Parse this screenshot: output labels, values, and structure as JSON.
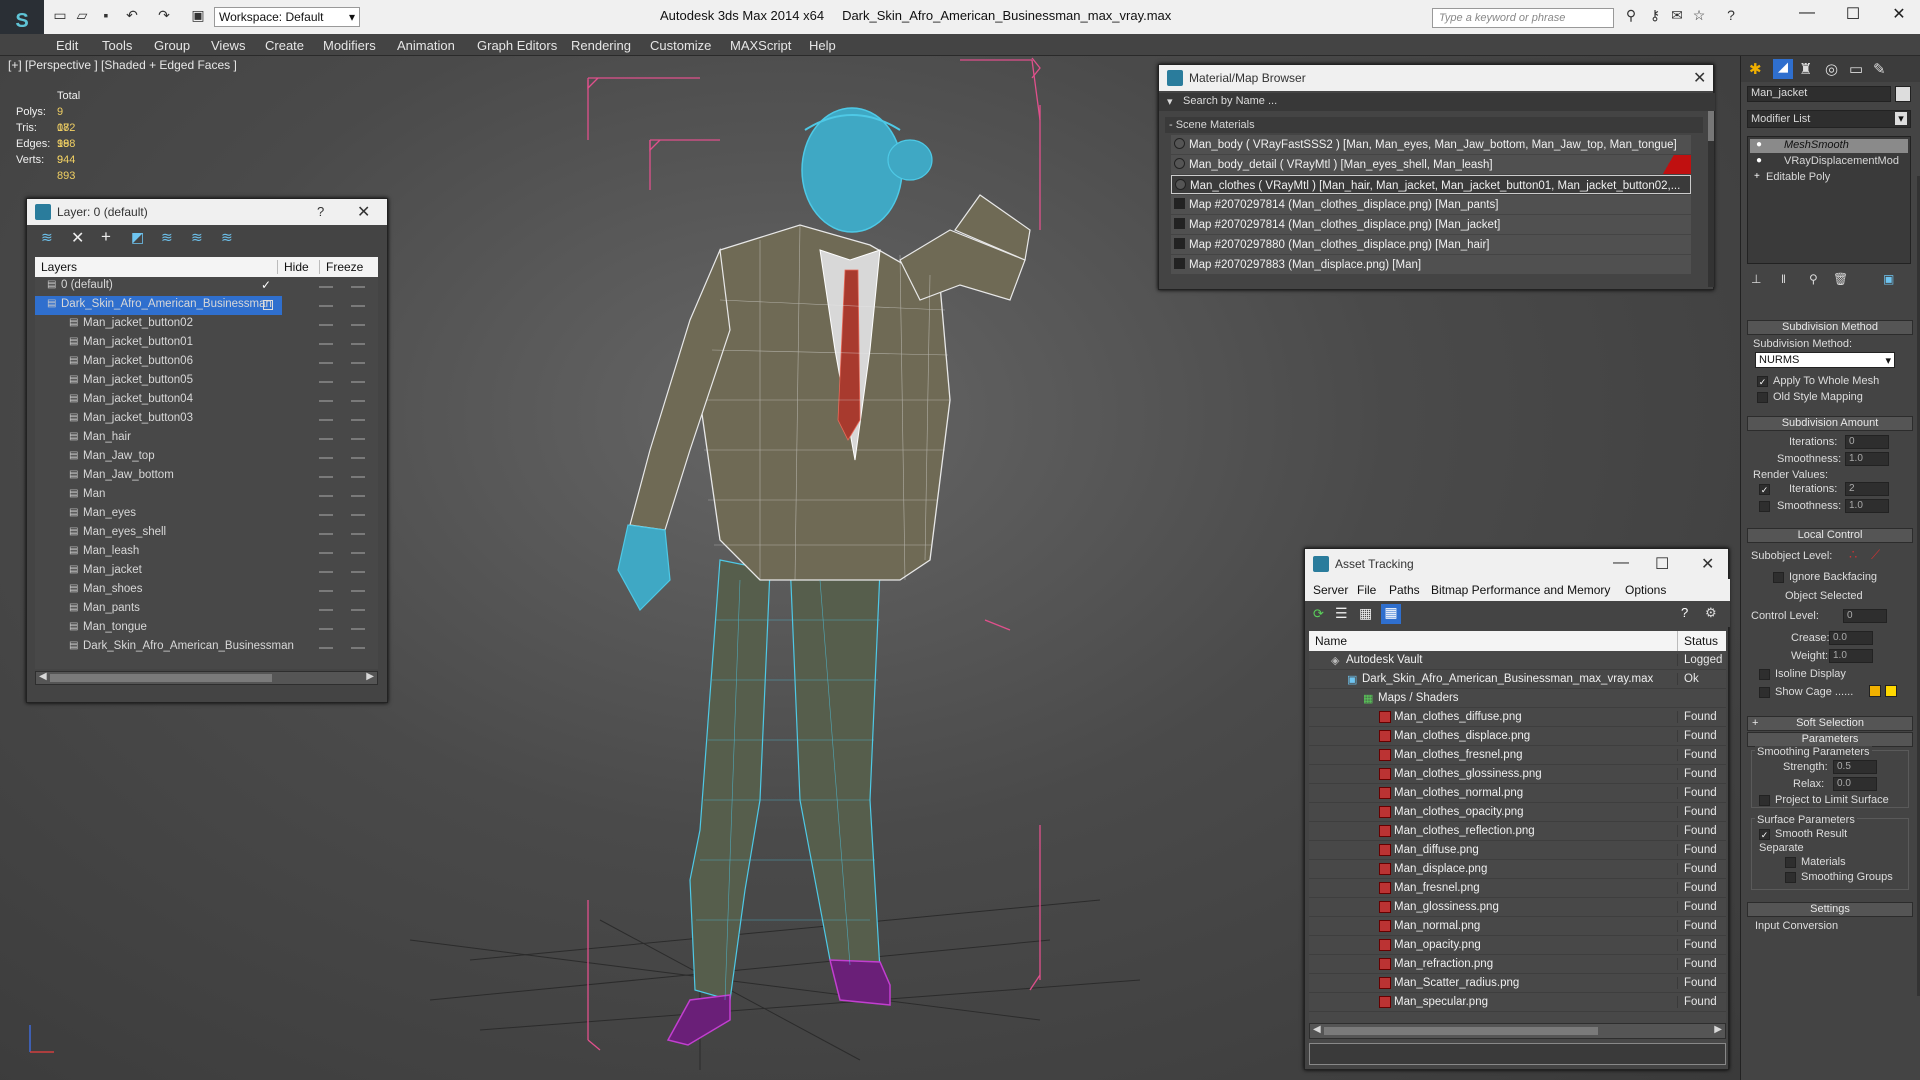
{
  "app": {
    "title": "Autodesk 3ds Max  2014 x64",
    "filename": "Dark_Skin_Afro_American_Businessman_max_vray.max",
    "workspace": "Workspace: Default",
    "search_placeholder": "Type a keyword or phrase"
  },
  "menu": [
    "Edit",
    "Tools",
    "Group",
    "Views",
    "Create",
    "Modifiers",
    "Animation",
    "Graph Editors",
    "Rendering",
    "Customize",
    "MAXScript",
    "Help"
  ],
  "viewport": {
    "label": "[+] [Perspective ] [Shaded + Edged Faces ]",
    "stats": {
      "header": "Total",
      "rows": [
        {
          "k": "Polys:",
          "v": "9 082"
        },
        {
          "k": "Tris:",
          "v": "17 998"
        },
        {
          "k": "Edges:",
          "v": "18 944"
        },
        {
          "k": "Verts:",
          "v": "9 893"
        }
      ]
    }
  },
  "layer": {
    "title": "Layer: 0 (default)",
    "help": "?",
    "col_layers": "Layers",
    "col_hide": "Hide",
    "col_freeze": "Freeze",
    "items": [
      {
        "name": "0 (default)",
        "level": 0,
        "check": "✓"
      },
      {
        "name": "Dark_Skin_Afro_American_Businessman",
        "level": 0,
        "selected": true
      },
      {
        "name": "Man_jacket_button02",
        "level": 1
      },
      {
        "name": "Man_jacket_button01",
        "level": 1
      },
      {
        "name": "Man_jacket_button06",
        "level": 1
      },
      {
        "name": "Man_jacket_button05",
        "level": 1
      },
      {
        "name": "Man_jacket_button04",
        "level": 1
      },
      {
        "name": "Man_jacket_button03",
        "level": 1
      },
      {
        "name": "Man_hair",
        "level": 1
      },
      {
        "name": "Man_Jaw_top",
        "level": 1
      },
      {
        "name": "Man_Jaw_bottom",
        "level": 1
      },
      {
        "name": "Man",
        "level": 1
      },
      {
        "name": "Man_eyes",
        "level": 1
      },
      {
        "name": "Man_eyes_shell",
        "level": 1
      },
      {
        "name": "Man_leash",
        "level": 1
      },
      {
        "name": "Man_jacket",
        "level": 1
      },
      {
        "name": "Man_shoes",
        "level": 1
      },
      {
        "name": "Man_pants",
        "level": 1
      },
      {
        "name": "Man_tongue",
        "level": 1
      },
      {
        "name": "Dark_Skin_Afro_American_Businessman",
        "level": 1
      }
    ]
  },
  "mat": {
    "title": "Material/Map Browser",
    "search": "Search by Name ...",
    "group": "- Scene Materials",
    "items": [
      "Man_body  ( VRayFastSSS2 )  [Man, Man_eyes, Man_Jaw_bottom, Man_Jaw_top, Man_tongue]",
      "Man_body_detail  ( VRayMtl )  [Man_eyes_shell, Man_leash]",
      "Man_clothes  ( VRayMtl )  [Man_hair, Man_jacket, Man_jacket_button01, Man_jacket_button02,...",
      "Map #2070297814 (Man_clothes_displace.png)  [Man_pants]",
      "Map #2070297814 (Man_clothes_displace.png)  [Man_jacket]",
      "Map #2070297880 (Man_clothes_displace.png)  [Man_hair]",
      "Map #2070297883 (Man_displace.png)  [Man]"
    ]
  },
  "asset": {
    "title": "Asset Tracking",
    "menu": [
      "Server",
      "File",
      "Paths",
      "Bitmap Performance and Memory",
      "Options"
    ],
    "col_name": "Name",
    "col_status": "Status",
    "rows": [
      {
        "name": "Autodesk Vault",
        "status": "Logged O",
        "level": 0
      },
      {
        "name": "Dark_Skin_Afro_American_Businessman_max_vray.max",
        "status": "Ok",
        "level": 1
      },
      {
        "name": "Maps / Shaders",
        "status": "",
        "level": 2
      },
      {
        "name": "Man_clothes_diffuse.png",
        "status": "Found",
        "level": 3
      },
      {
        "name": "Man_clothes_displace.png",
        "status": "Found",
        "level": 3
      },
      {
        "name": "Man_clothes_fresnel.png",
        "status": "Found",
        "level": 3
      },
      {
        "name": "Man_clothes_glossiness.png",
        "status": "Found",
        "level": 3
      },
      {
        "name": "Man_clothes_normal.png",
        "status": "Found",
        "level": 3
      },
      {
        "name": "Man_clothes_opacity.png",
        "status": "Found",
        "level": 3
      },
      {
        "name": "Man_clothes_reflection.png",
        "status": "Found",
        "level": 3
      },
      {
        "name": "Man_diffuse.png",
        "status": "Found",
        "level": 3
      },
      {
        "name": "Man_displace.png",
        "status": "Found",
        "level": 3
      },
      {
        "name": "Man_fresnel.png",
        "status": "Found",
        "level": 3
      },
      {
        "name": "Man_glossiness.png",
        "status": "Found",
        "level": 3
      },
      {
        "name": "Man_normal.png",
        "status": "Found",
        "level": 3
      },
      {
        "name": "Man_opacity.png",
        "status": "Found",
        "level": 3
      },
      {
        "name": "Man_refraction.png",
        "status": "Found",
        "level": 3
      },
      {
        "name": "Man_Scatter_radius.png",
        "status": "Found",
        "level": 3
      },
      {
        "name": "Man_specular.png",
        "status": "Found",
        "level": 3
      }
    ]
  },
  "cmd": {
    "object_name": "Man_jacket",
    "modifier_list": "Modifier List",
    "stack": [
      "MeshSmooth",
      "VRayDisplacementMod",
      "Editable Poly"
    ],
    "subdiv_method": "Subdivision Method",
    "subdiv_method_label": "Subdivision Method:",
    "subdiv_value": "NURMS",
    "apply_whole": "Apply To Whole Mesh",
    "old_style": "Old Style Mapping",
    "subdiv_amount": "Subdivision Amount",
    "iterations": "Iterations:",
    "iterations_v": "0",
    "smoothness": "Smoothness:",
    "smoothness_v": "1.0",
    "render_values": "Render Values:",
    "r_iterations_v": "2",
    "r_smoothness_v": "1.0",
    "local_control": "Local Control",
    "subobject": "Subobject Level:",
    "ignore_backfacing": "Ignore Backfacing",
    "object_selected": "Object Selected",
    "control_level": "Control Level:",
    "control_level_v": "0",
    "crease": "Crease:",
    "crease_v": "0.0",
    "weight": "Weight:",
    "weight_v": "1.0",
    "isoline": "Isoline Display",
    "show_cage": "Show Cage ......",
    "soft_sel": "Soft Selection",
    "parameters": "Parameters",
    "smoothing_params": "Smoothing Parameters",
    "strength": "Strength:",
    "strength_v": "0.5",
    "relax": "Relax:",
    "relax_v": "0.0",
    "project": "Project to Limit Surface",
    "surface_params": "Surface Parameters",
    "smooth_result": "Smooth Result",
    "separate": "Separate",
    "materials": "Materials",
    "smoothing_groups": "Smoothing Groups",
    "settings": "Settings",
    "input_conversion": "Input Conversion"
  },
  "colors": {
    "wire": "#4ec9e6",
    "jacket": "#6f6a55",
    "pants": "#565e4c",
    "bbox": "#e0508c",
    "shoes": "#c23fd0",
    "cage1": "#f0b000",
    "cage2": "#ffd800",
    "select": "#2f6fce"
  }
}
